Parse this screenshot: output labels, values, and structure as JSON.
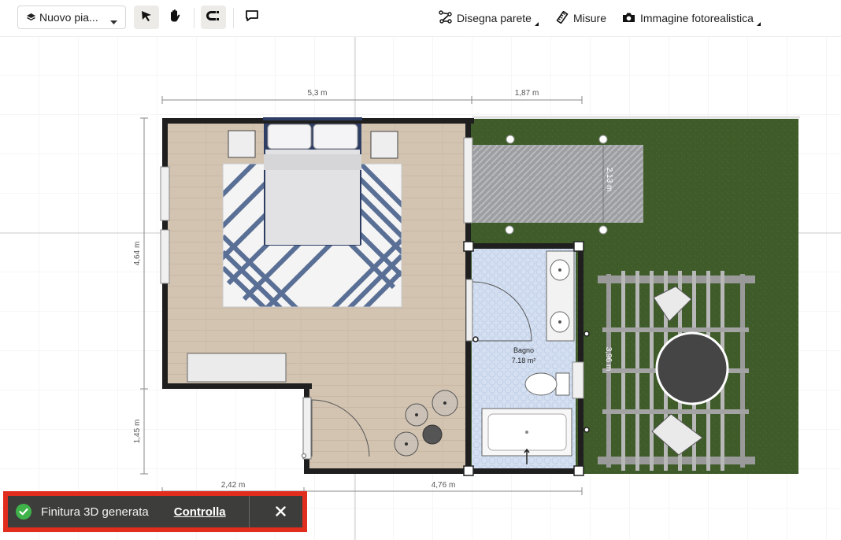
{
  "toolbar": {
    "floor_selector_label": "Nuovo pia...",
    "draw_wall_label": "Disegna parete",
    "measures_label": "Misure",
    "photo_label": "Immagine fotorealistica"
  },
  "icons": {
    "floor": "layers-icon",
    "caret": "chevron-down-icon",
    "select": "cursor-arrow-icon",
    "pan": "hand-icon",
    "magnet": "magnet-icon",
    "comment": "comment-icon",
    "draw_wall": "polyline-icon",
    "measure": "ruler-icon",
    "camera": "camera-icon",
    "success": "check-circle-icon",
    "close": "close-icon"
  },
  "plan": {
    "dimensions": {
      "top_width": "5,3 m",
      "top_patio": "1,87 m",
      "left_height": "4,64 m",
      "left_lower": "1,45 m",
      "bottom_left": "2,42 m",
      "bottom_right": "4,76 m",
      "patio_depth": "2,13 m",
      "pergola_depth": "3,96 m"
    },
    "room_name": "Bagno",
    "room_area": "7.18 m²"
  },
  "toast": {
    "message": "Finitura 3D generata",
    "action": "Controlla"
  },
  "colors": {
    "wall": "#1f1f1f",
    "wood_floor": "#d3c4b2",
    "grass": "#3e5b29",
    "bath_tile": "#cfdcf0",
    "toast_bg": "#3d3e3b",
    "toast_border": "#e12d1d",
    "success": "#3fb34a"
  }
}
